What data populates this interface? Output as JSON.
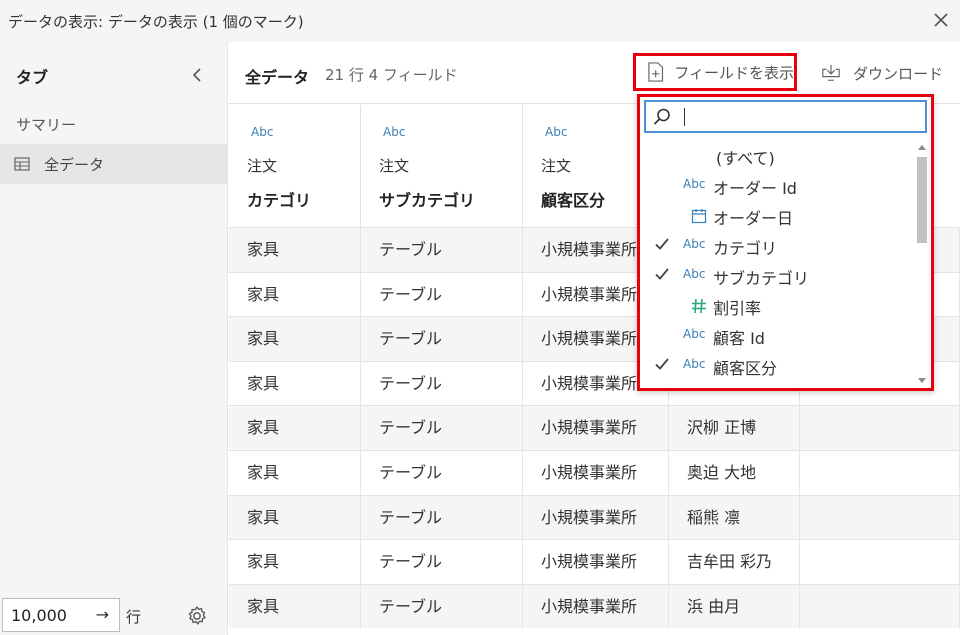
{
  "window": {
    "title": "データの表示: データの表示 (1 個のマーク)"
  },
  "sidebar": {
    "tabs_title": "タブ",
    "summary": "サマリー",
    "all_data": "全データ",
    "rows_value": "10,000",
    "rows_arrow": "→",
    "rows_label": "行"
  },
  "toolbar": {
    "title": "全データ",
    "meta": "21 行 4 フィールド",
    "show_fields": "フィールドを表示",
    "download": "ダウンロード"
  },
  "columns": [
    {
      "type": "Abc",
      "source": "注文",
      "name": "カテゴリ"
    },
    {
      "type": "Abc",
      "source": "注文",
      "name": "サブカテゴリ"
    },
    {
      "type": "Abc",
      "source": "注文",
      "name": "顧客区分"
    },
    {
      "type": "",
      "source": "",
      "name": ""
    }
  ],
  "rows": [
    [
      "家具",
      "テーブル",
      "小規模事業所",
      ""
    ],
    [
      "家具",
      "テーブル",
      "小規模事業所",
      ""
    ],
    [
      "家具",
      "テーブル",
      "小規模事業所",
      ""
    ],
    [
      "家具",
      "テーブル",
      "小規模事業所",
      ""
    ],
    [
      "家具",
      "テーブル",
      "小規模事業所",
      "沢柳 正博"
    ],
    [
      "家具",
      "テーブル",
      "小規模事業所",
      "奥迫 大地"
    ],
    [
      "家具",
      "テーブル",
      "小規模事業所",
      "稲熊 凛"
    ],
    [
      "家具",
      "テーブル",
      "小規模事業所",
      "吉牟田 彩乃"
    ],
    [
      "家具",
      "テーブル",
      "小規模事業所",
      "浜 由月"
    ]
  ],
  "field_dropdown": {
    "search_value": "",
    "items": [
      {
        "label": "(すべて)",
        "type": "",
        "checked": false
      },
      {
        "label": "オーダー Id",
        "type": "Abc",
        "checked": false
      },
      {
        "label": "オーダー日",
        "type": "date",
        "checked": false
      },
      {
        "label": "カテゴリ",
        "type": "Abc",
        "checked": true
      },
      {
        "label": "サブカテゴリ",
        "type": "Abc",
        "checked": true
      },
      {
        "label": "割引率",
        "type": "number",
        "checked": false
      },
      {
        "label": "顧客 Id",
        "type": "Abc",
        "checked": false
      },
      {
        "label": "顧客区分",
        "type": "Abc",
        "checked": true
      }
    ]
  },
  "icons": {
    "close": "close-icon",
    "collapse": "chevron-left-icon",
    "table": "table-icon",
    "settings": "gear-icon",
    "add_field": "add-field-icon",
    "download": "download-icon",
    "search": "search-icon"
  },
  "colors": {
    "highlight_border": "#e8000c",
    "type_abc": "#3b7fb8",
    "type_number": "#2aa876",
    "focus": "#4d90d6"
  }
}
